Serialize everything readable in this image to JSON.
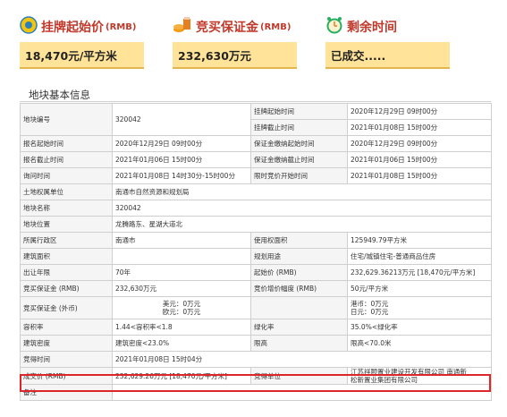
{
  "header": {
    "price_title": "挂牌起始价",
    "price_unit": "(RMB)",
    "deposit_title": "竞买保证金",
    "deposit_unit": "(RMB)",
    "time_title": "剩余时间"
  },
  "values": {
    "price": "18,470元/平方米",
    "deposit": "232,630万元",
    "status": "已成交....."
  },
  "section_title": "地块基本信息",
  "table": {
    "r1": {
      "label": "地块编号",
      "value": "320042",
      "label2": "挂牌起始时间",
      "value2": "2020年12月29日 09时00分"
    },
    "r2": {
      "label2": "挂牌截止时间",
      "value2": "2021年01月08日 15时00分"
    },
    "r3": {
      "label": "报名起始时间",
      "value": "2020年12月29日 09时00分",
      "label2": "保证金缴纳起始时间",
      "value2": "2020年12月29日 09时00分"
    },
    "r4": {
      "label": "报名截止时间",
      "value": "2021年01月06日 15时00分",
      "label2": "保证金缴纳截止时间",
      "value2": "2021年01月06日 15时00分"
    },
    "r5": {
      "label": "询问时间",
      "value": "2021年01月08日 14时30分-15时00分",
      "label2": "限时竞价开始时间",
      "value2": "2021年01月08日 15时00分"
    },
    "r6": {
      "label": "土地权属单位",
      "value": "南通市自然资源和规划局"
    },
    "r7": {
      "label": "地块名称",
      "value": "320042"
    },
    "r8": {
      "label": "地块位置",
      "value": "龙腾路东、星湖大道北"
    },
    "r9": {
      "label": "所属行政区",
      "value": "南通市",
      "label2": "使用权面积",
      "value2": "125949.79平方米"
    },
    "r10": {
      "label": "建筑面积",
      "value": "",
      "label2": "规划用途",
      "value2": "住宅/城镇住宅-普通商品住房"
    },
    "r11": {
      "label": "出让年限",
      "value": "70年",
      "label2": "起始价 (RMB)",
      "value2": "232,629.36213万元 [18,470元/平方米]"
    },
    "r12": {
      "label": "竞买保证金 (RMB)",
      "value": "232,630万元",
      "label2": "竞价增价幅度 (RMB)",
      "value2": "50元/平方米"
    },
    "r13": {
      "label": "竞买保证金 (外币)",
      "value_a": "美元：0万元",
      "value_b": "欧元：0万元",
      "label2": "",
      "value2_a": "港币：0万元",
      "value2_b": "日元：0万元"
    },
    "r14": {
      "label": "容积率",
      "value": "1.44<容积率<1.8",
      "label2": "绿化率",
      "value2": "35.0%<绿化率"
    },
    "r15": {
      "label": "建筑密度",
      "value": "建筑密度<23.0%",
      "label2": "限高",
      "value2": "限高<70.0米"
    },
    "r16": {
      "label": "竞得时间",
      "value": "2021年01月08日 15时04分"
    },
    "r17": {
      "label": "成交价 (RMB)",
      "value": "232,629.26万元 [18,470元/平方米]",
      "label2": "竞得单位",
      "value2_a": "江苏祥颐置业建设开发有限公司 南通新",
      "value2_b": "松新置业集团有限公司"
    },
    "r18": {
      "label": "备注",
      "value": ""
    }
  }
}
